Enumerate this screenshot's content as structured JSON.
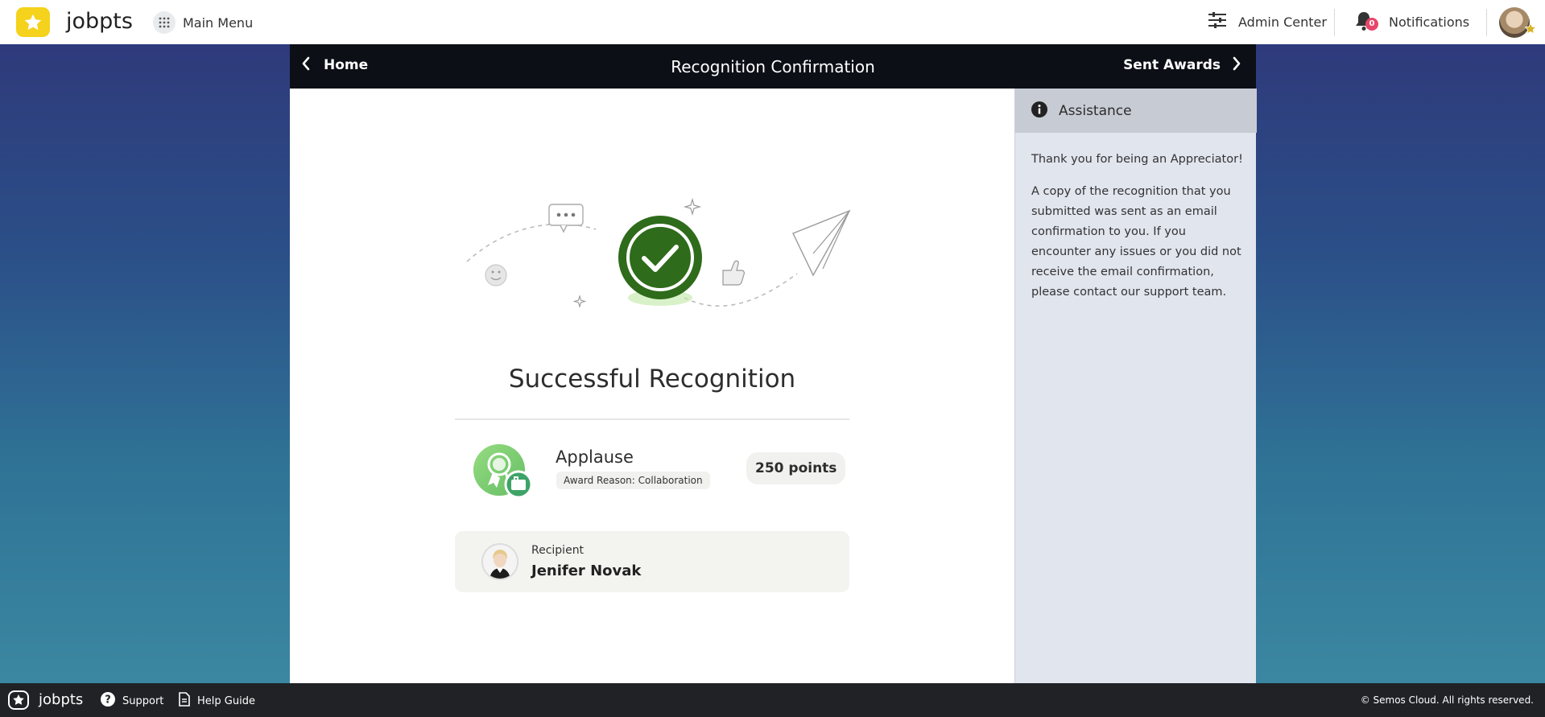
{
  "topbar": {
    "brand": "jobpts",
    "main_menu_label": "Main Menu",
    "admin_center_label": "Admin Center",
    "notifications_label": "Notifications",
    "notifications_count": "0",
    "accent_color": "#f5d21c"
  },
  "panel": {
    "back_label": "Home",
    "title": "Recognition Confirmation",
    "forward_label": "Sent Awards"
  },
  "confirmation": {
    "headline": "Successful Recognition",
    "award_name": "Applause",
    "award_reason": "Award Reason: Collaboration",
    "points": "250 points",
    "recipient_caption": "Recipient",
    "recipient_name": "Jenifer Novak",
    "success_color": "#2e6b1a"
  },
  "assistance": {
    "title": "Assistance",
    "line1": "Thank you for being an Appreciator!",
    "paragraph": "A copy of the recognition that you submitted was sent as an email confirmation to you. If you encounter any issues or you did not receive the email confirmation, please contact our support team."
  },
  "footer": {
    "brand": "jobpts",
    "support_label": "Support",
    "help_label": "Help Guide",
    "copyright": "© Semos Cloud. All rights reserved."
  },
  "icons": [
    "star-logo-icon",
    "grid-icon",
    "sliders-icon",
    "bell-icon",
    "chevron-left-icon",
    "chevron-right-icon",
    "info-icon",
    "check-icon",
    "award-ribbon-icon",
    "question-icon",
    "document-icon"
  ]
}
